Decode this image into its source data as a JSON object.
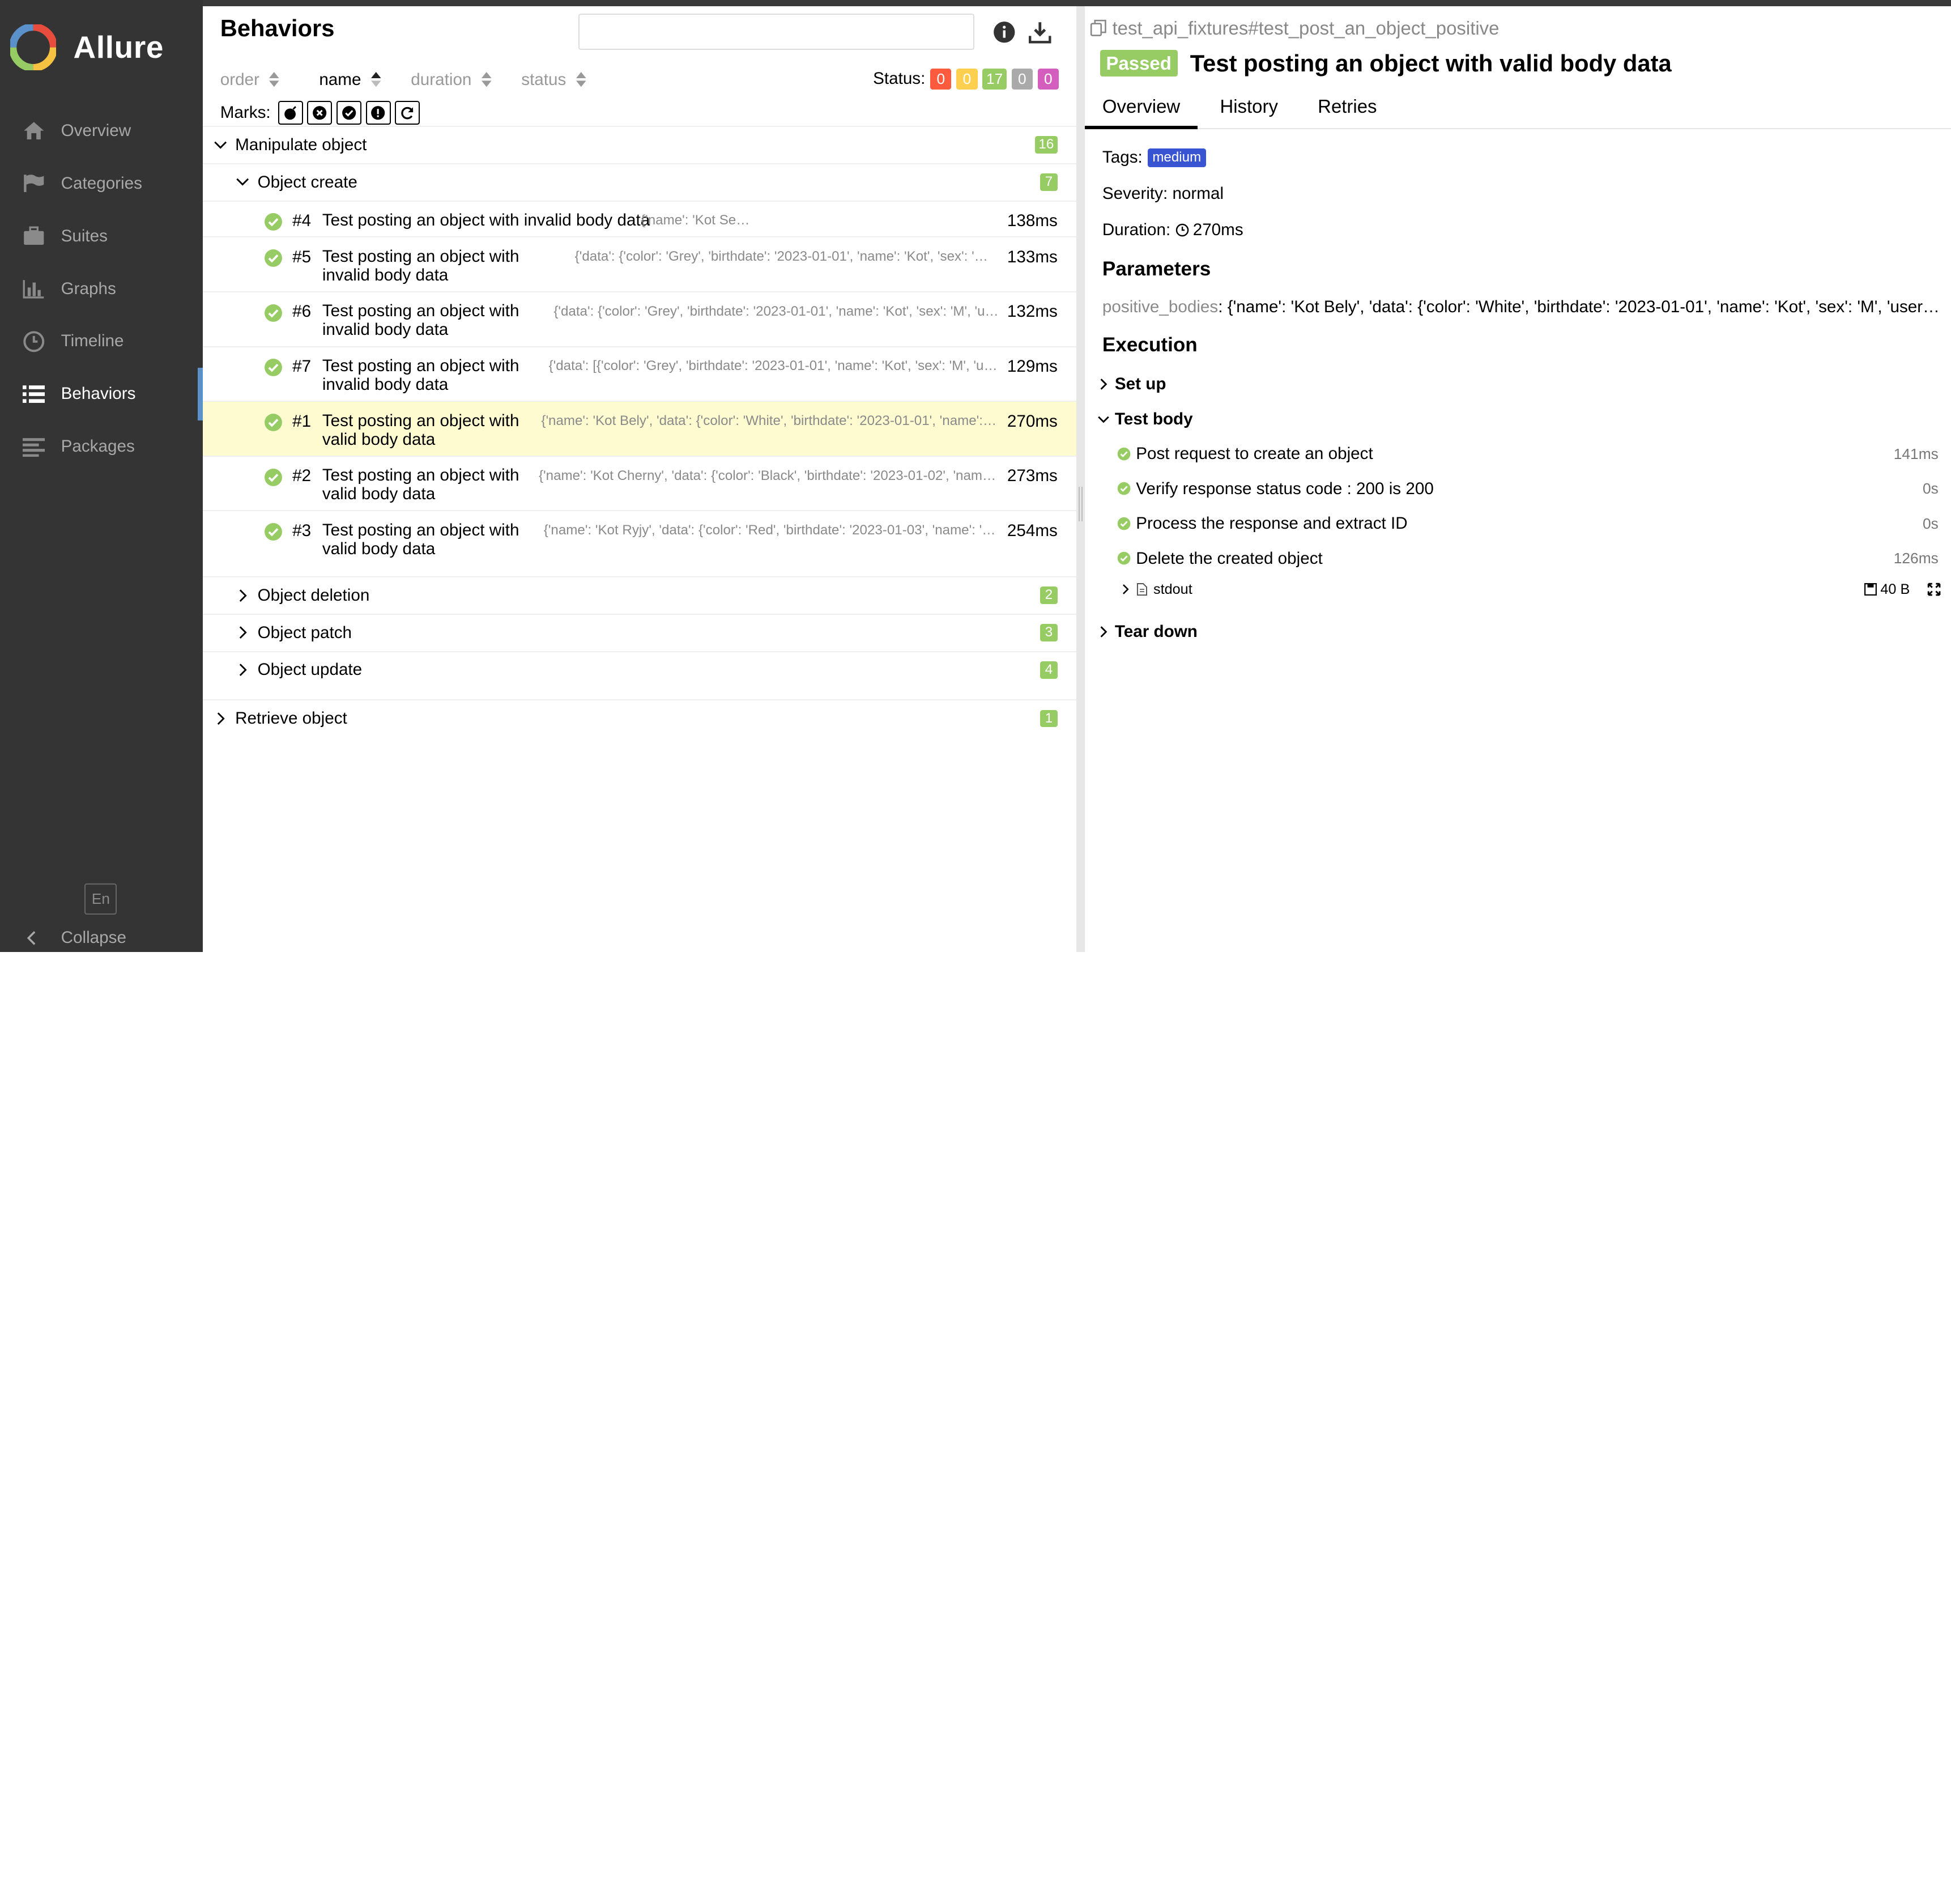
{
  "brand": {
    "name": "Allure"
  },
  "sidebar": {
    "items": [
      {
        "label": "Overview",
        "icon": "home-icon"
      },
      {
        "label": "Categories",
        "icon": "flag-icon"
      },
      {
        "label": "Suites",
        "icon": "briefcase-icon"
      },
      {
        "label": "Graphs",
        "icon": "bar-chart-icon"
      },
      {
        "label": "Timeline",
        "icon": "clock-icon"
      },
      {
        "label": "Behaviors",
        "icon": "list-icon",
        "active": true
      },
      {
        "label": "Packages",
        "icon": "align-left-icon"
      }
    ],
    "language": "En",
    "collapse": "Collapse"
  },
  "center": {
    "title": "Behaviors",
    "search": {
      "placeholder": "",
      "value": ""
    },
    "sort": [
      "order",
      "name",
      "duration",
      "status"
    ],
    "status_label": "Status:",
    "status_counts": [
      {
        "value": "0",
        "color": "#fd5a3e"
      },
      {
        "value": "0",
        "color": "#ffd050"
      },
      {
        "value": "17",
        "color": "#97cc64"
      },
      {
        "value": "0",
        "color": "#aaaaaa"
      },
      {
        "value": "0",
        "color": "#d35ebe"
      }
    ],
    "marks_label": "Marks:",
    "tree": {
      "feature": {
        "name": "Manipulate object",
        "count": "16"
      },
      "story": {
        "name": "Object create",
        "count": "7"
      },
      "tests": [
        {
          "num": "#4",
          "name": "Test posting an object with invalid body data",
          "params": "{'name': 'Kot Sery'}",
          "duration": "138ms"
        },
        {
          "num": "#5",
          "name": "Test posting an object with invalid body data",
          "params": "{'data': {'color': 'Grey', 'birthdate': '2023-01-01', 'name': 'Kot', 'sex': 'M', 'username': 'kot_sery'}}",
          "duration": "133ms"
        },
        {
          "num": "#6",
          "name": "Test posting an object with invalid body data",
          "params": "{'data': {'color': 'Grey', 'birthdate': '2023-01-01', 'name': 'Kot', 'sex': 'M', 'username': 'kot_sery'}}",
          "duration": "132ms"
        },
        {
          "num": "#7",
          "name": "Test posting an object with invalid body data",
          "params": "{'data': [{'color': 'Grey', 'birthdate': '2023-01-01', 'name': 'Kot', 'sex': 'M', 'username': 'kot_sery'}]}",
          "duration": "129ms"
        },
        {
          "num": "#1",
          "name": "Test posting an object with valid body data",
          "params": "{'name': 'Kot Bely', 'data': {'color': 'White', 'birthdate': '2023-01-01', 'name': 'Kot', 'sex': 'M'}}",
          "duration": "270ms",
          "selected": true
        },
        {
          "num": "#2",
          "name": "Test posting an object with valid body data",
          "params": "{'name': 'Kot Cherny', 'data': {'color': 'Black', 'birthdate': '2023-01-02', 'name': 'Kot', 'sex': 'M'}}",
          "duration": "273ms"
        },
        {
          "num": "#3",
          "name": "Test posting an object with valid body data",
          "params": "{'name': 'Kot Ryjy', 'data': {'color': 'Red', 'birthdate': '2023-01-03', 'name': 'Kot', 'sex': 'M'}}",
          "duration": "254ms"
        }
      ],
      "other_stories": [
        {
          "name": "Object deletion",
          "count": "2"
        },
        {
          "name": "Object patch",
          "count": "3"
        },
        {
          "name": "Object update",
          "count": "4"
        }
      ],
      "other_feature": {
        "name": "Retrieve object",
        "count": "1"
      }
    }
  },
  "detail": {
    "path": "test_api_fixtures#test_post_an_object_positive",
    "status": "Passed",
    "title": "Test posting an object with valid body data",
    "tabs": [
      "Overview",
      "History",
      "Retries"
    ],
    "tags_label": "Tags:",
    "tag": "medium",
    "severity": "Severity: normal",
    "duration_label": "Duration:",
    "duration": "270ms",
    "parameters_title": "Parameters",
    "param_key": "positive_bodies",
    "param_value": ": {'name': 'Kot Bely', 'data': {'color': 'White', 'birthdate': '2023-01-01', 'name': 'Kot', 'sex': 'M', 'username': 'kot_bely'}}",
    "execution_title": "Execution",
    "setup": "Set up",
    "test_body": "Test body",
    "steps": [
      {
        "name": "Post request to create an object",
        "duration": "141ms"
      },
      {
        "name": "Verify response status code : 200 is 200",
        "duration": "0s"
      },
      {
        "name": "Process the response and extract ID",
        "duration": "0s"
      },
      {
        "name": "Delete the created object",
        "duration": "126ms"
      }
    ],
    "attachment": {
      "name": "stdout",
      "size": "40 B"
    },
    "teardown": "Tear down"
  }
}
